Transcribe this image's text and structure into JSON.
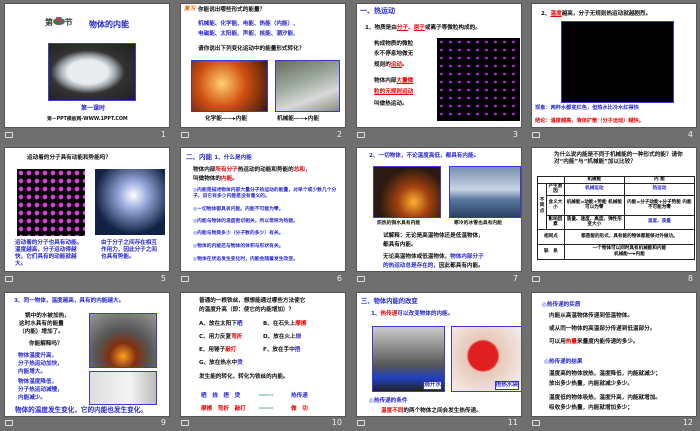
{
  "slides": [
    {
      "num": "1",
      "chapter_prefix": "第",
      "chapter_num": "5",
      "chapter_suffix": "节",
      "title": "物体的内能",
      "lesson": "第一课时",
      "site": "第一PPT模板网-WWW.1PPT.COM"
    },
    {
      "num": "2",
      "badge": "复习",
      "q1": "你能说出哪些形式的能量？",
      "forms1": "机械能、化学能、电能、热能（内能）、",
      "forms2": "电磁能、太阳能、声能、核能、潮汐能、",
      "q2": "请你说出下列变化运动中的能量形式转化？",
      "cap1_from": "化学能",
      "cap1_to": "内能",
      "cap2_from": "机械能",
      "cap2_to": "内能"
    },
    {
      "num": "3",
      "heading": "一、热运动",
      "l1a": "1、物质是由",
      "l1b": "分子",
      "l1c": "、",
      "l1d": "原子",
      "l1e": "或离子等微粒构成的。",
      "p1": "构成物质的微粒",
      "p2": "永不停息地做无",
      "p3a": "规则的",
      "p3b": "运动",
      "p3c": "。",
      "p4a": "物体内部",
      "p4b": "大量微",
      "p5": "粒的无规则运动",
      "p6": "叫做热运动。"
    },
    {
      "num": "4",
      "l1a": "2、",
      "l1b": "温度",
      "l1c": "越高，分子无规则热运动就越剧烈。",
      "obs": "现象：两杯水都变红色，但热水比冷水红得快",
      "concl": "结论：温度越高，液体扩散（分子运动）越快。"
    },
    {
      "num": "5",
      "q": "运动着的分子具有动能和势能吗？",
      "left": "运动着的分子也具有动能。温度越高，分子运动得越快，它们具有的动能就越大。",
      "right": "由于分子之间存在相互作用力，因此分子之间也具有势能。"
    },
    {
      "num": "6",
      "h1": "二、内能",
      "h2": "1、什么是内能",
      "d1a": "物体内部",
      "d1b": "所有分子",
      "d1c": "热运动的动能和势能的",
      "d1d": "总和",
      "d1e": "，",
      "d2a": "叫做物体的",
      "d2b": "内能",
      "d2c": "。",
      "items": [
        "◎内能是描述物体内部大量分子热运动的能量，对单个或少数几个分子，说它有多少内能是没有意义的。",
        "◎一切物体都具有内能。内能不可能为零。",
        "◎内能与物体的温度密切相关，所以常称为热能。",
        "◎内能与物质多少（分子数的多少）有关。",
        "◎物体的内能还与物体的体积与形状有关。",
        "◎物体在状态发生变化时，内能会随着发生改变。"
      ]
    },
    {
      "num": "7",
      "heading": "2、一切物体，不论温度高低，都具有内能。",
      "cap1": "炽热的铜水具有内能",
      "cap2": "寒冷的冰雪也具有内能",
      "ex1": "试解释：无论是高温物体还是低温物体，",
      "ex2": "都具有内能。",
      "a1a": "无论高温物体或低温物体，",
      "a1b": "物体内部分子",
      "a2a": "的热运动总是存在的",
      "a2b": "，因此都具有内能。"
    },
    {
      "num": "8",
      "q": "为什么说内能是不同于机械能的一种形式的能？请你对“内能”与“机械能”加以比较？",
      "h_mech": "机械能",
      "h_int": "内 能",
      "group": "不同点",
      "rows": [
        {
          "k": "产生原因",
          "m": "机械运动",
          "i": "热运动"
        },
        {
          "k": "含义大小",
          "m": "机械能=动能+势能 机械能可以为零",
          "i": "内能=分子动能+分子势能 内能不可能为零"
        },
        {
          "k": "影响因素",
          "m": "质量、速度、高度、弹性形变大小",
          "i": "温度、质量"
        }
      ],
      "same_k": "相同点",
      "same_v": "都是能的形式，具有能的物体都能够对外做功。",
      "rel_k": "联　系",
      "rel_v": "一个物体可以同时具有机械能和内能",
      "rel_from": "机械能",
      "rel_to": "内能"
    },
    {
      "num": "9",
      "heading": "3、同一物体，温度越高，具有的内能越大。",
      "t1": "锅中的水被加热，",
      "t2": "这时水具有的能量",
      "t3": "（内能）增加了。",
      "q": "你能解释吗？",
      "b1": "物体温度升高，",
      "b2": "分子热运动加快，",
      "b3": "内能增大。",
      "b4": "物体温度降低，",
      "b5": "分子热运动减慢，",
      "b6": "内能减少。",
      "concl": "物体的温度发生变化，它的内能也发生变化。"
    },
    {
      "num": "10",
      "q1": "普通的一根铁丝，想想能通过哪些方法使它",
      "q2": "的温度升高（即：使它的内能增加）？",
      "opts": [
        {
          "t": "A、放在太阳下",
          "k": "晒"
        },
        {
          "t": "B、在石头上",
          "k": "摩擦"
        },
        {
          "t": "C、用力反复",
          "k": "弯折"
        },
        {
          "t": "D、放在火上",
          "k": "烧"
        },
        {
          "t": "E、用锤子",
          "k": "敲打"
        },
        {
          "t": "F、放在手中",
          "k": "捂"
        },
        {
          "t": "G、放在热水中",
          "k": "烫"
        }
      ],
      "note": "发生能的转化，转化为铁丝的内能。",
      "row1": "晒　烧　捂　烫",
      "res1": "热传递",
      "row2": "摩擦　弯折　敲打",
      "res2": "做　功"
    },
    {
      "num": "11",
      "heading": "三、物体内能的改变",
      "s1a": "1、",
      "s1b": "热传递",
      "s1c": "可以改变物体的内能。",
      "lab1": "烧开水",
      "lab2": "捂热水袋",
      "cond": "◎热传递的条件",
      "c1a": "温度不同",
      "c1b": "的两个物体之间会发生热传递。"
    },
    {
      "num": "12",
      "h1": "◎热传递的实质",
      "p1": "内能从高温物体传递到低温物体。",
      "p2": "或从同一物体的高温部分传递到低温部分。",
      "p3a": "可以用",
      "p3b": "热量",
      "p3c": "来量度内能传递的多少。",
      "h2": "◎热传递的结果",
      "r1": "温度高的物体放热，温度降低，内能就减少；",
      "r2": "放出多少热量，内能就减少多少。",
      "r3": "温度低的物体吸热，温度升高，内能就增加。",
      "r4": "吸收多少热量，内能就增加多少；"
    }
  ]
}
